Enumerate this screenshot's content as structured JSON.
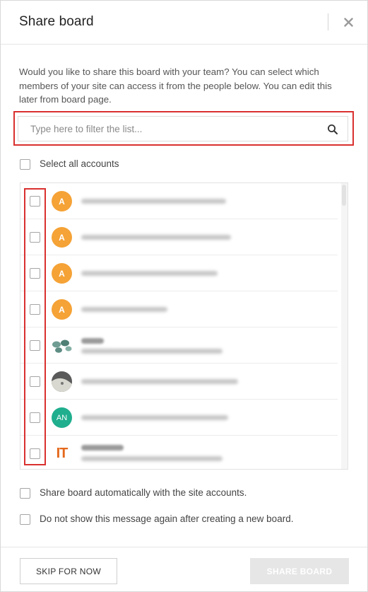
{
  "dialog": {
    "title": "Share board",
    "description": "Would you like to share this board with your team? You can select which members of your site can access it from the people below. You can edit this later from board page."
  },
  "filter": {
    "placeholder": "Type here to filter the list..."
  },
  "select_all_label": "Select all accounts",
  "accounts": [
    {
      "avatar_text": "A",
      "avatar_type": "letter",
      "avatar_color": "#f5a236"
    },
    {
      "avatar_text": "A",
      "avatar_type": "letter",
      "avatar_color": "#f5a236"
    },
    {
      "avatar_text": "A",
      "avatar_type": "letter",
      "avatar_color": "#f5a236"
    },
    {
      "avatar_text": "A",
      "avatar_type": "letter",
      "avatar_color": "#f5a236"
    },
    {
      "avatar_text": "",
      "avatar_type": "photo"
    },
    {
      "avatar_text": "",
      "avatar_type": "photo"
    },
    {
      "avatar_text": "AN",
      "avatar_type": "letter",
      "avatar_color": "#1fae8e"
    },
    {
      "avatar_text": "IT",
      "avatar_type": "logo",
      "avatar_color": "#e4691c"
    }
  ],
  "options": {
    "auto_share_label": "Share board automatically with the site accounts.",
    "dont_show_label": "Do not show this message again after creating a new board."
  },
  "buttons": {
    "skip_label": "SKIP FOR NOW",
    "share_label": "SHARE BOARD"
  },
  "colors": {
    "highlight_outline": "#d9302f",
    "avatar_orange": "#f5a236",
    "avatar_teal": "#1fae8e",
    "share_disabled_bg": "#e6e6e6"
  }
}
